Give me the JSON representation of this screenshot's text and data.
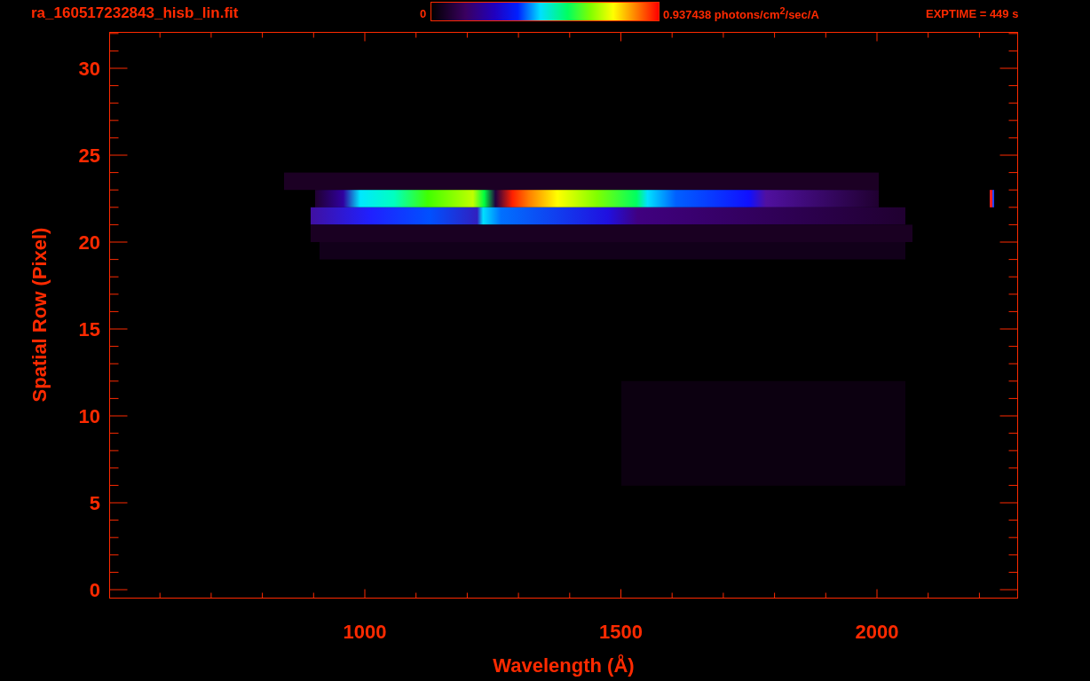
{
  "header": {
    "filename": "ra_160517232843_hisb_lin.fit",
    "colorbar": {
      "min_label": "0",
      "max_label": "0.937438 photons/cm$^{2}$/sec/A"
    },
    "exposure": "EXPTIME = 449 s"
  },
  "plot": {
    "x_axis": {
      "title": "Wavelength (Å)",
      "tick_labels": [
        "1000",
        "1500",
        "2000"
      ]
    },
    "y_axis": {
      "title": "Spatial Row (Pixel)",
      "tick_labels": [
        "30",
        "25",
        "20",
        "15",
        "10",
        "5",
        "0"
      ]
    }
  }
}
